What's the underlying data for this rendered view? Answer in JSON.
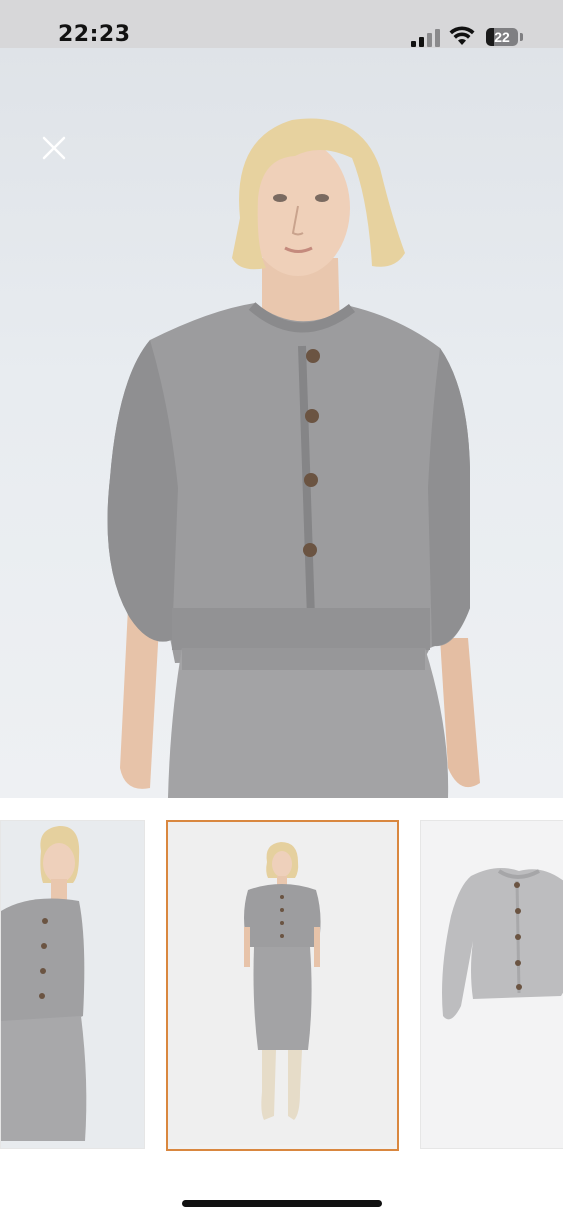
{
  "status_bar": {
    "time": "22:23",
    "battery": "22",
    "icons": [
      "signal-icon",
      "wifi-icon",
      "battery-icon"
    ]
  },
  "viewer": {
    "close_icon": "close-icon",
    "main_image": "product-photo-model-grey-cardigan-and-knit-skirt",
    "thumbnails": [
      {
        "name": "thumbnail-model-closeup",
        "selected": false
      },
      {
        "name": "thumbnail-full-body-outfit",
        "selected": true
      },
      {
        "name": "thumbnail-cardigan-flat",
        "selected": false
      }
    ],
    "selected_border_color": "#d9873f"
  },
  "colors": {
    "garment": "#9a9a9c",
    "hair": "#e6cf9a",
    "skin": "#e9c6ad"
  }
}
